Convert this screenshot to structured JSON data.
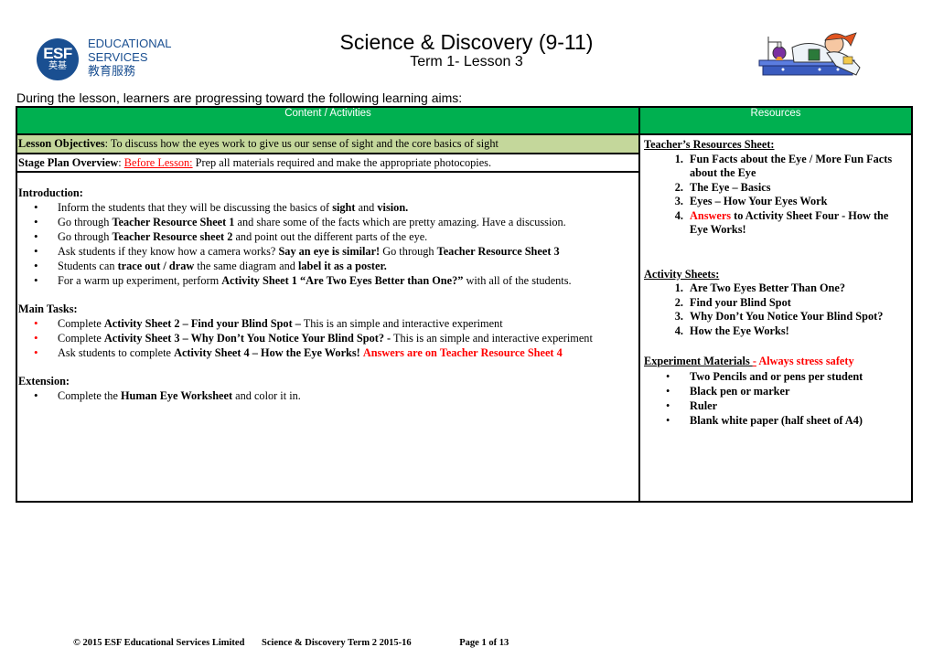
{
  "logo": {
    "abbr": "ESF",
    "abbr_cn": "英基",
    "line1": "EDUCATIONAL",
    "line2": "SERVICES",
    "line3": "教育服務",
    "color": "#1a4f91"
  },
  "header": {
    "title": "Science & Discovery (9-11)",
    "subtitle": "Term 1- Lesson 3"
  },
  "intro_text": "During the lesson, learners are progressing toward the following learning aims:",
  "table": {
    "header_color": "#00b050",
    "columns": [
      "Content / Activities",
      "Resources"
    ],
    "objectives": {
      "label": "Lesson Objectives",
      "text": ":  To discuss how the eyes work to give us our sense of sight and the core basics of sight"
    },
    "overview": {
      "label": "Stage Plan Overview",
      "sep": ":  ",
      "link": "Before Lesson:",
      "text": " Prep all materials required and make the appropriate photocopies."
    },
    "introduction": {
      "heading": "Introduction:",
      "items": [
        {
          "parts": [
            {
              "t": "Inform the students that they will be discussing the basics of ",
              "b": false
            },
            {
              "t": "sight",
              "b": true
            },
            {
              "t": " and ",
              "b": false
            },
            {
              "t": "vision.",
              "b": true
            }
          ]
        },
        {
          "parts": [
            {
              "t": "Go through ",
              "b": false
            },
            {
              "t": "Teacher Resource Sheet 1",
              "b": true
            },
            {
              "t": " and share some of the facts which are pretty amazing. Have a discussion.",
              "b": false
            }
          ]
        },
        {
          "parts": [
            {
              "t": "Go through ",
              "b": false
            },
            {
              "t": "Teacher Resource sheet 2",
              "b": true
            },
            {
              "t": " and point out the different parts of the eye.",
              "b": false
            }
          ]
        },
        {
          "parts": [
            {
              "t": "Ask students if they know how a camera works? ",
              "b": false
            },
            {
              "t": "Say an eye is similar!",
              "b": true
            },
            {
              "t": " Go through ",
              "b": false
            },
            {
              "t": "Teacher Resource Sheet 3",
              "b": true
            }
          ]
        },
        {
          "parts": [
            {
              "t": "Students can ",
              "b": false
            },
            {
              "t": "trace out / draw",
              "b": true
            },
            {
              "t": " the same diagram and ",
              "b": false
            },
            {
              "t": "label it as a poster.",
              "b": true
            }
          ]
        },
        {
          "parts": [
            {
              "t": "For a warm up experiment, perform ",
              "b": false
            },
            {
              "t": "Activity Sheet 1 “Are Two Eyes Better than One?”",
              "b": true
            },
            {
              "t": " with all of the students.",
              "b": false
            }
          ]
        }
      ]
    },
    "main_tasks": {
      "heading": "Main Tasks:",
      "items": [
        {
          "parts": [
            {
              "t": "Complete ",
              "b": false
            },
            {
              "t": "Activity Sheet 2 – Find your Blind Spot –",
              "b": true
            },
            {
              "t": " This is an simple and interactive experiment",
              "b": false
            }
          ]
        },
        {
          "parts": [
            {
              "t": "Complete ",
              "b": false
            },
            {
              "t": "Activity Sheet 3 – Why Don’t You Notice Your Blind Spot? -",
              "b": true
            },
            {
              "t": " This is an simple and interactive experiment",
              "b": false
            }
          ]
        },
        {
          "parts": [
            {
              "t": "Ask students to complete ",
              "b": false
            },
            {
              "t": "Activity Sheet 4 – How the Eye Works!",
              "b": true
            },
            {
              "t": " ",
              "b": false
            },
            {
              "t": "Answers are on Teacher Resource Sheet 4",
              "b": true,
              "red": true
            }
          ]
        }
      ]
    },
    "extension": {
      "heading": "Extension:",
      "items": [
        {
          "parts": [
            {
              "t": "Complete the ",
              "b": false
            },
            {
              "t": "Human Eye Worksheet",
              "b": true
            },
            {
              "t": " and color it in.",
              "b": false
            }
          ]
        }
      ]
    },
    "resources": {
      "teacher_heading": "Teacher’s Resources Sheet:",
      "teacher_items": [
        {
          "red": "",
          "text": "Fun Facts about the Eye / More Fun Facts about the Eye"
        },
        {
          "red": "",
          "text": "The Eye – Basics"
        },
        {
          "red": "",
          "text": "Eyes – How Your Eyes Work"
        },
        {
          "red": "Answers",
          "text": " to Activity Sheet Four - How the Eye Works!"
        }
      ],
      "activity_heading": "Activity Sheets:",
      "activity_items": [
        "Are Two Eyes Better Than One?",
        "Find your Blind Spot",
        "Why Don’t You Notice Your Blind Spot?",
        "How the Eye Works!"
      ],
      "materials_heading": "Experiment Materials ",
      "materials_dash": "-",
      "materials_note": " Always stress safety",
      "materials_items": [
        "Two Pencils and or pens per student",
        "Black pen or marker",
        "Ruler",
        "Blank white paper (half sheet of A4)"
      ]
    }
  },
  "footer": {
    "copyright": "© 2015 ESF Educational Services Limited",
    "course": "Science & Discovery Term 2 2015-16",
    "page": "Page 1 of 13"
  }
}
